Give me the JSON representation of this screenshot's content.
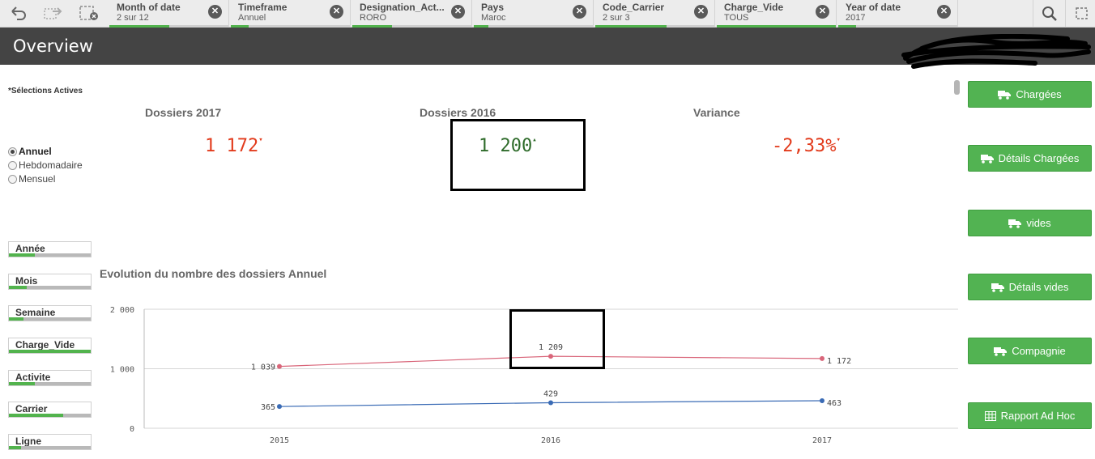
{
  "selection_bar": {
    "filters": [
      {
        "title": "Month of date",
        "value": "2 sur 12",
        "fill": 0.5
      },
      {
        "title": "Timeframe",
        "value": "Annuel",
        "fill": 0.15
      },
      {
        "title": "Designation_Act...",
        "value": "RORO",
        "fill": 0.33
      },
      {
        "title": "Pays",
        "value": "Maroc",
        "fill": 0.12
      },
      {
        "title": "Code_Carrier",
        "value": "2 sur 3",
        "fill": 0.6
      },
      {
        "title": "Charge_Vide",
        "value": "TOUS",
        "fill": 1.0
      },
      {
        "title": "Year of date",
        "value": "2017",
        "fill": 0.15
      }
    ],
    "clear_glyph": "✕"
  },
  "sheet": {
    "title": "Overview"
  },
  "left_panel": {
    "active_selections_label": "*Sélections Actives",
    "timeframe_options": [
      {
        "label": "Annuel",
        "selected": true
      },
      {
        "label": "Hebdomadaire",
        "selected": false
      },
      {
        "label": "Mensuel",
        "selected": false
      }
    ],
    "filters": [
      {
        "label": "Année",
        "fill": 0.32
      },
      {
        "label": "Mois",
        "fill": 0.22
      },
      {
        "label": "Semaine",
        "fill": 0.18
      },
      {
        "label": "Charge_Vide",
        "fill": 1.0
      },
      {
        "label": "Activite",
        "fill": 0.32
      },
      {
        "label": "Carrier",
        "fill": 0.66
      },
      {
        "label": "Ligne",
        "fill": 0.15
      }
    ]
  },
  "kpis": [
    {
      "title": "Dossiers 2017",
      "value": "1 172",
      "color": "#e23b1c"
    },
    {
      "title": "Dossiers 2016",
      "value": "1 200",
      "color": "#2e6b2a"
    },
    {
      "title": "Variance",
      "value": "-2,33%",
      "color": "#e23b1c"
    }
  ],
  "chart_data": {
    "type": "line",
    "title": "Evolution du nombre des dossiers Annuel",
    "x": [
      "2015",
      "2016",
      "2017"
    ],
    "ylim": [
      0,
      2000
    ],
    "yticks": [
      "0",
      "1 000",
      "2 000"
    ],
    "ytick_values": [
      0,
      1000,
      2000
    ],
    "series": [
      {
        "values": [
          1039,
          1209,
          1172
        ],
        "labels": [
          "1 039",
          "1 209",
          "1 172"
        ],
        "color": "#d9667a"
      },
      {
        "values": [
          365,
          429,
          463
        ],
        "labels": [
          "365",
          "429",
          "463"
        ],
        "color": "#3a6bb5"
      }
    ],
    "grid": true
  },
  "right_buttons": [
    {
      "label": "Chargées",
      "icon": "truck-icon"
    },
    {
      "label": "Détails Chargées",
      "icon": "truck-icon"
    },
    {
      "label": "vides",
      "icon": "truck-icon"
    },
    {
      "label": "Détails vides",
      "icon": "truck-icon"
    },
    {
      "label": "Compagnie",
      "icon": "truck-icon"
    },
    {
      "label": "Rapport Ad Hoc",
      "icon": "table-icon"
    }
  ],
  "colors": {
    "accent": "#52b34d",
    "header": "#444444"
  }
}
